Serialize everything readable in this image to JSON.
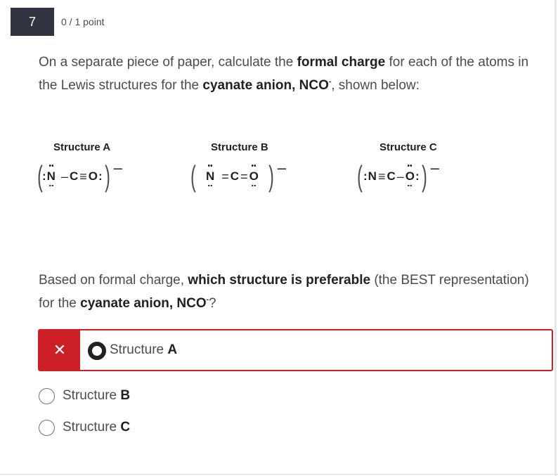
{
  "question": {
    "number": "7",
    "points": "0 / 1 point"
  },
  "prompt": {
    "part1": "On a separate piece of paper, calculate the ",
    "bold1": "formal charge",
    "part2": " for each of the atoms in the Lewis structures for the ",
    "bold2": "cyanate anion, NCO",
    "sup": "-",
    "part3": ", shown below:"
  },
  "structures": [
    {
      "title": "Structure A",
      "atoms": [
        "N",
        "C",
        "O"
      ],
      "bonds": [
        "–",
        "≡"
      ],
      "charge": "–"
    },
    {
      "title": "Structure B",
      "atoms": [
        "N",
        "C",
        "O"
      ],
      "bonds": [
        "=",
        "="
      ],
      "charge": "–"
    },
    {
      "title": "Structure C",
      "atoms": [
        "N",
        "C",
        "O"
      ],
      "bonds": [
        "≡",
        "–"
      ],
      "charge": "–"
    }
  ],
  "question2": {
    "part1": "Based on formal charge, ",
    "bold1": "which structure is preferable",
    "part2": " (the BEST representation) for the ",
    "bold2": "cyanate anion, NCO",
    "sup": "-",
    "part3": "?"
  },
  "options": [
    {
      "prefix": "Structure ",
      "letter": "A",
      "selected": true,
      "incorrect": true
    },
    {
      "prefix": "Structure ",
      "letter": "B",
      "selected": false
    },
    {
      "prefix": "Structure ",
      "letter": "C",
      "selected": false
    }
  ],
  "feedback": {
    "incorrect_mark": "✕"
  },
  "colors": {
    "qnum_bg": "#313541",
    "error_red": "#cd2026",
    "text": "#494c4e"
  }
}
